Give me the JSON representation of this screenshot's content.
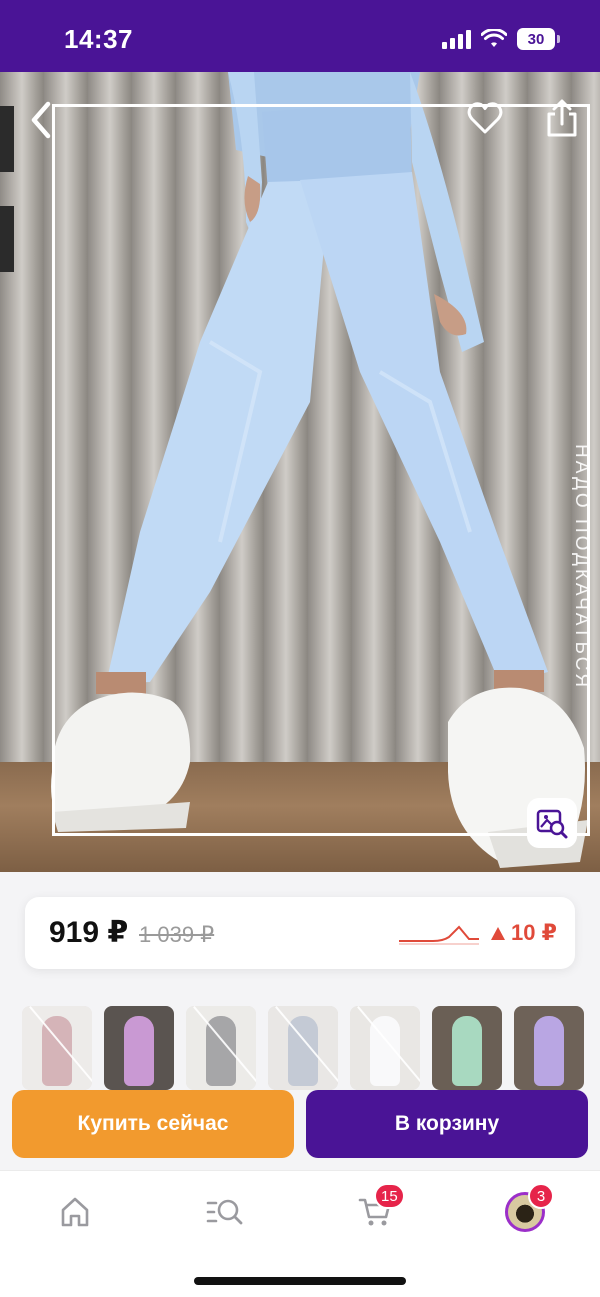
{
  "status_bar": {
    "time": "14:37",
    "battery": "30"
  },
  "photo": {
    "caption": "НАДО ПОДКАЧАТЬСЯ",
    "back_icon": "chevron-left-icon",
    "favorite_icon": "heart-icon",
    "share_icon": "share-icon",
    "visual_search_icon": "image-search-icon"
  },
  "price": {
    "current": "919 ₽",
    "old": "1 039 ₽",
    "change": "10 ₽",
    "change_direction": "up",
    "change_color": "#e04a3a"
  },
  "thumbnails": [
    {
      "index": 1,
      "color": "#a35a63"
    },
    {
      "index": 2,
      "color": "#c999d3"
    },
    {
      "index": 3,
      "color": "#3a3a3e"
    },
    {
      "index": 4,
      "color": "#7d8aa3"
    },
    {
      "index": 5,
      "color": "#f2f2f4"
    },
    {
      "index": 6,
      "color": "#a8d9c0"
    },
    {
      "index": 7,
      "color": "#b9a6e3"
    }
  ],
  "actions": {
    "buy_now": "Купить сейчас",
    "add_to_cart": "В корзину"
  },
  "tab_bar": {
    "home_icon": "home-icon",
    "catalog_icon": "catalog-search-icon",
    "cart_icon": "cart-icon",
    "cart_badge": "15",
    "profile_badge": "3"
  },
  "colors": {
    "brand": "#4a1496",
    "accent_orange": "#f29a2e",
    "badge": "#e6244a"
  }
}
